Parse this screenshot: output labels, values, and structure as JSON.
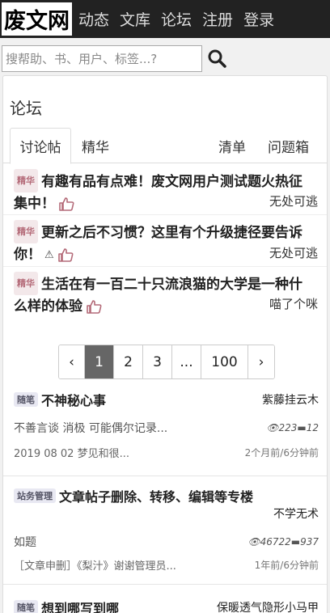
{
  "header": {
    "logo": "废文网",
    "nav": [
      "动态",
      "文库",
      "论坛",
      "注册",
      "登录"
    ]
  },
  "search": {
    "placeholder": "搜帮助、书、用户、标签...?"
  },
  "forum": {
    "title": "论坛",
    "tabs": [
      "讨论帖",
      "精华",
      "清单",
      "问题箱"
    ]
  },
  "featured": [
    {
      "tag": "精华",
      "title": "有趣有品有点难！废文网用户测试题火热征集中！",
      "author": "无处可逃"
    },
    {
      "tag": "精华",
      "title": "更新之后不习惯？这里有个升级捷径要告诉你！",
      "author": "无处可逃"
    },
    {
      "tag": "精华",
      "title": "生活在有一百二十只流浪猫的大学是一种什么样的体验",
      "author": "喵了个咪"
    }
  ],
  "pagination": {
    "prev": "‹",
    "pages": [
      "1",
      "2",
      "3",
      "...",
      "100"
    ],
    "next": "›"
  },
  "posts": [
    {
      "tag": "随笔",
      "title": "不神秘心事",
      "author": "紫藤挂云木",
      "excerpt": "不善言谈 消极 可能偶尔记录...",
      "views": "223",
      "replies": "12",
      "last_reply": "2019 08 02 梦见和很...",
      "time": "2个月前/6分钟前"
    },
    {
      "tag": "站务管理",
      "title": "文章帖子删除、转移、编辑等专楼",
      "author": "不学无术",
      "excerpt": "如题",
      "views": "46722",
      "replies": "937",
      "last_reply": "［文章申删］《梨汁》谢谢管理员...",
      "time": "1年前/6分钟前"
    },
    {
      "tag": "随笔",
      "title": "想到哪写到哪",
      "author": "保暖透气隐形小马甲"
    }
  ],
  "colors": {
    "topbar": "#222222",
    "accent": "#b46a78",
    "active_page": "#666666"
  }
}
